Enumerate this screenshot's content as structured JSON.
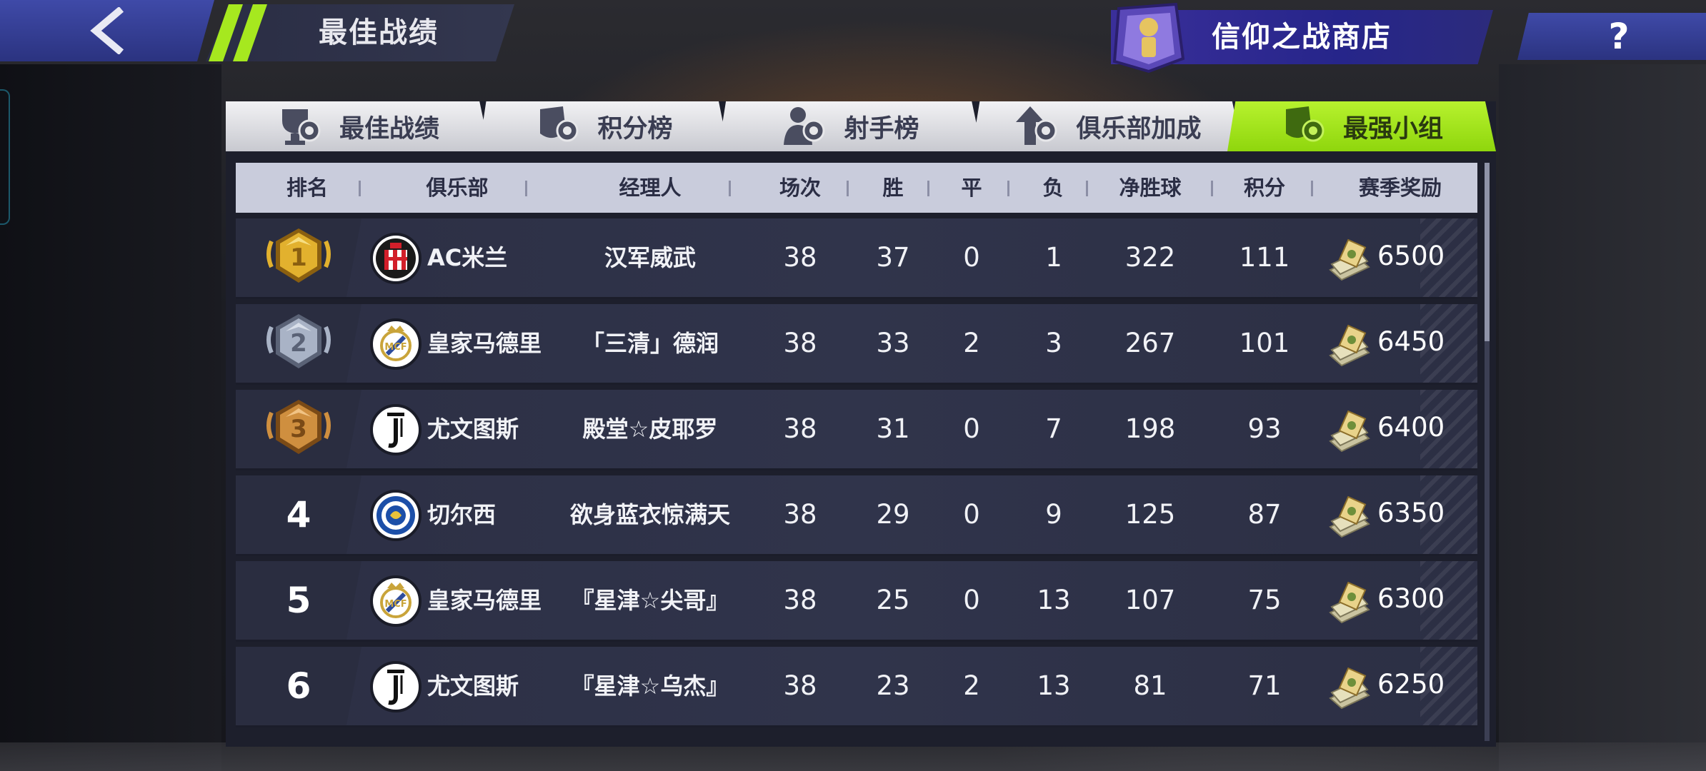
{
  "header": {
    "title": "最佳战绩",
    "shop_label": "信仰之战商店",
    "help_label": "?"
  },
  "tabs": [
    {
      "label": "最佳战绩",
      "icon": "trophy-badge-icon",
      "active": false
    },
    {
      "label": "积分榜",
      "icon": "shield-badge-icon",
      "active": false
    },
    {
      "label": "射手榜",
      "icon": "player-badge-icon",
      "active": false
    },
    {
      "label": "俱乐部加成",
      "icon": "arrow-up-badge-icon",
      "active": false
    },
    {
      "label": "最强小组",
      "icon": "shield-badge-icon",
      "active": true
    }
  ],
  "table": {
    "columns": [
      "排名",
      "俱乐部",
      "经理人",
      "场次",
      "胜",
      "平",
      "负",
      "净胜球",
      "积分",
      "赛季奖励"
    ],
    "rows": [
      {
        "rank": "1",
        "club": "AC米兰",
        "manager": "汉军威武",
        "played": "38",
        "win": "37",
        "draw": "0",
        "loss": "1",
        "gd": "322",
        "points": "111",
        "reward": "6500",
        "crest": "milan-crest-icon"
      },
      {
        "rank": "2",
        "club": "皇家马德里",
        "manager": "「三清」德润",
        "played": "38",
        "win": "33",
        "draw": "2",
        "loss": "3",
        "gd": "267",
        "points": "101",
        "reward": "6450",
        "crest": "real-madrid-crest-icon"
      },
      {
        "rank": "3",
        "club": "尤文图斯",
        "manager": "殿堂☆皮耶罗",
        "played": "38",
        "win": "31",
        "draw": "0",
        "loss": "7",
        "gd": "198",
        "points": "93",
        "reward": "6400",
        "crest": "juventus-crest-icon"
      },
      {
        "rank": "4",
        "club": "切尔西",
        "manager": "欲身蓝衣惊满天",
        "played": "38",
        "win": "29",
        "draw": "0",
        "loss": "9",
        "gd": "125",
        "points": "87",
        "reward": "6350",
        "crest": "chelsea-crest-icon"
      },
      {
        "rank": "5",
        "club": "皇家马德里",
        "manager": "『星津☆尖哥』",
        "played": "38",
        "win": "25",
        "draw": "0",
        "loss": "13",
        "gd": "107",
        "points": "75",
        "reward": "6300",
        "crest": "real-madrid-crest-icon"
      },
      {
        "rank": "6",
        "club": "尤文图斯",
        "manager": "『星津☆乌杰』",
        "played": "38",
        "win": "23",
        "draw": "2",
        "loss": "13",
        "gd": "81",
        "points": "71",
        "reward": "6250",
        "crest": "juventus-crest-icon"
      }
    ]
  },
  "colors": {
    "accent_green": "#a6e81f",
    "header_blue": "#3a44a0",
    "gold": "#d9a82a",
    "silver": "#aab4c8",
    "bronze": "#c98a3a"
  }
}
